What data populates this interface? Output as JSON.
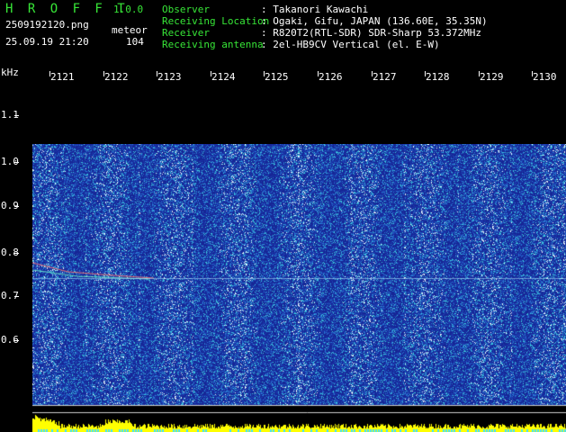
{
  "header": {
    "app_title": "H R O F F T",
    "version": "1.0.0",
    "filename": "2509192120.png",
    "datetime": "25.09.19 21:20",
    "mode_label": "meteor",
    "count": "104",
    "info": [
      {
        "label": "Observer",
        "value": ": Takanori Kawachi"
      },
      {
        "label": "Receiving Location",
        "value": ": Ogaki, Gifu, JAPAN (136.60E, 35.35N)"
      },
      {
        "label": "Receiver",
        "value": ": R820T2(RTL-SDR) SDR-Sharp 53.372MHz"
      },
      {
        "label": "Receiving antenna",
        "value": ": 2el-HB9CV Vertical (el. E-W)"
      }
    ]
  },
  "axes": {
    "y_unit": "kHz",
    "y_ticks": [
      "1.1",
      "1.0",
      "0.9",
      "0.8",
      "0.7",
      "0.6"
    ],
    "x_ticks": [
      "2121",
      "2122",
      "2123",
      "2124",
      "2125",
      "2126",
      "2127",
      "2128",
      "2129",
      "2130"
    ]
  },
  "colors": {
    "background": "#000000",
    "header_green": "#37e637",
    "header_white": "#ffffff",
    "spectrum_low": "#1a2a9c",
    "spectrum_mid": "#2ea8d8",
    "spectrum_high": "#ffffff",
    "signal_line": "#ff6060",
    "level_bars": "#ffff00"
  }
}
